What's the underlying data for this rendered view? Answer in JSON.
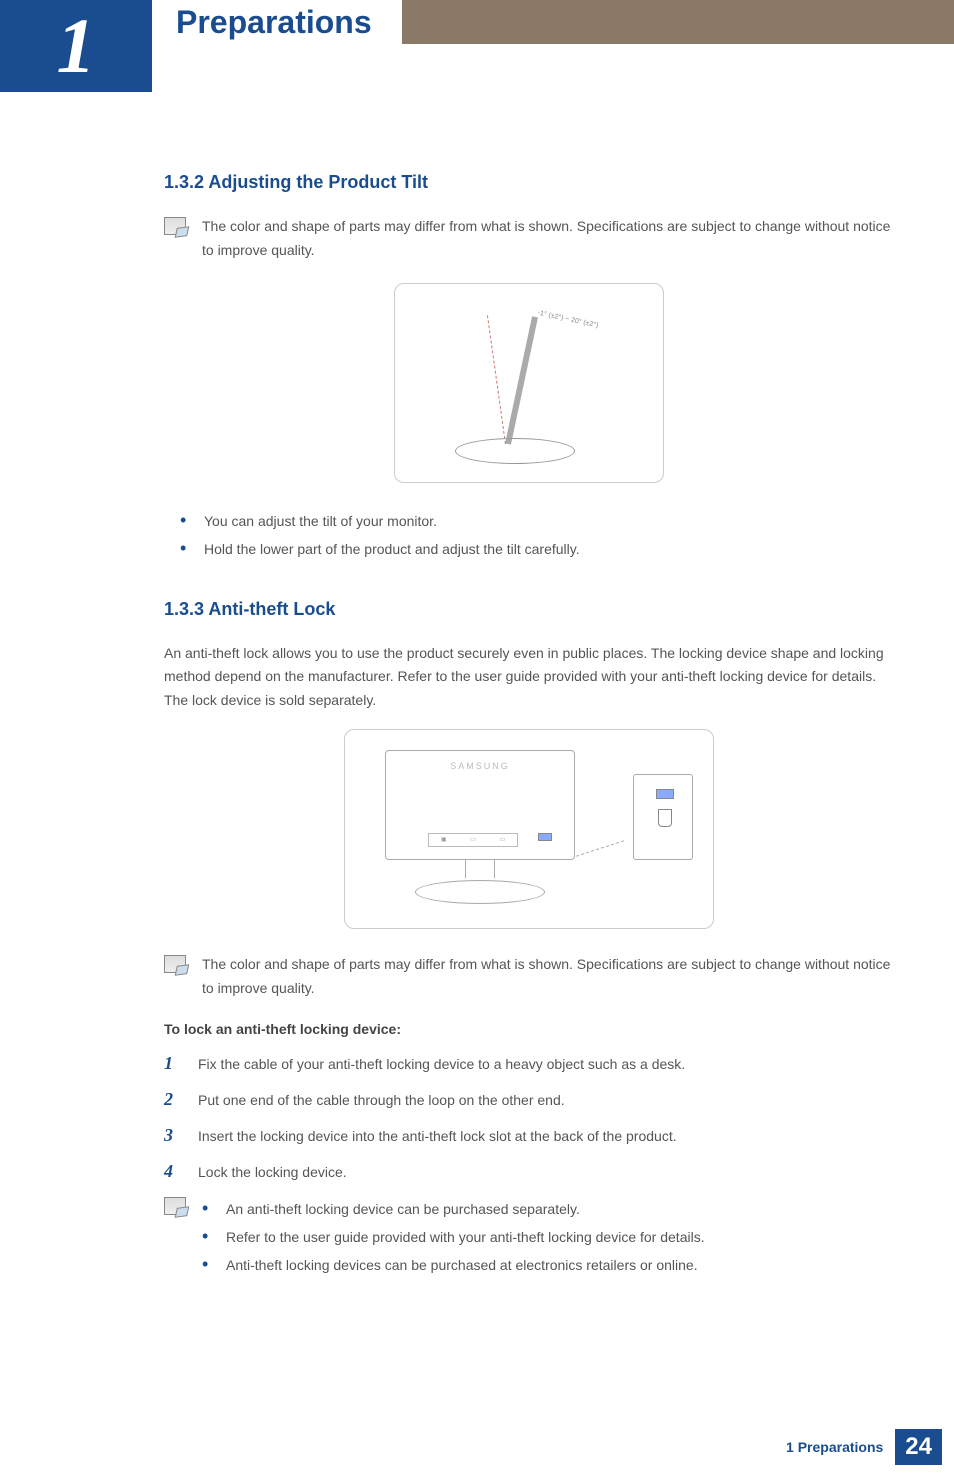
{
  "header": {
    "chapter_number": "1",
    "chapter_title": "Preparations"
  },
  "sections": {
    "tilt": {
      "heading": "1.3.2   Adjusting the Product Tilt",
      "note": "The color and shape of parts may differ from what is shown. Specifications are subject to change without notice to improve quality.",
      "tilt_label": "-1° (±2°) ~ 20° (±2°)",
      "bullets": [
        "You can adjust the tilt of your monitor.",
        "Hold the lower part of the product and adjust the tilt carefully."
      ]
    },
    "lock": {
      "heading": "1.3.3   Anti-theft Lock",
      "intro": "An anti-theft lock allows you to use the product securely even in public places. The locking device shape and locking method depend on the manufacturer. Refer to the user guide provided with your anti-theft locking device for details. The lock device is sold separately.",
      "brand_label": "SAMSUNG",
      "note2": "The color and shape of parts may differ from what is shown. Specifications are subject to change without notice to improve quality.",
      "subhead": "To lock an anti-theft locking device:",
      "steps": [
        "Fix the cable of your anti-theft locking device to a heavy object such as a desk.",
        "Put one end of the cable through the loop on the other end.",
        "Insert the locking device into the anti-theft lock slot at the back of the product.",
        "Lock the locking device."
      ],
      "tips": [
        "An anti-theft locking device can be purchased separately.",
        "Refer to the user guide provided with your anti-theft locking device for details.",
        "Anti-theft locking devices can be purchased at electronics retailers or online."
      ]
    }
  },
  "footer": {
    "label": "1 Preparations",
    "page": "24"
  }
}
